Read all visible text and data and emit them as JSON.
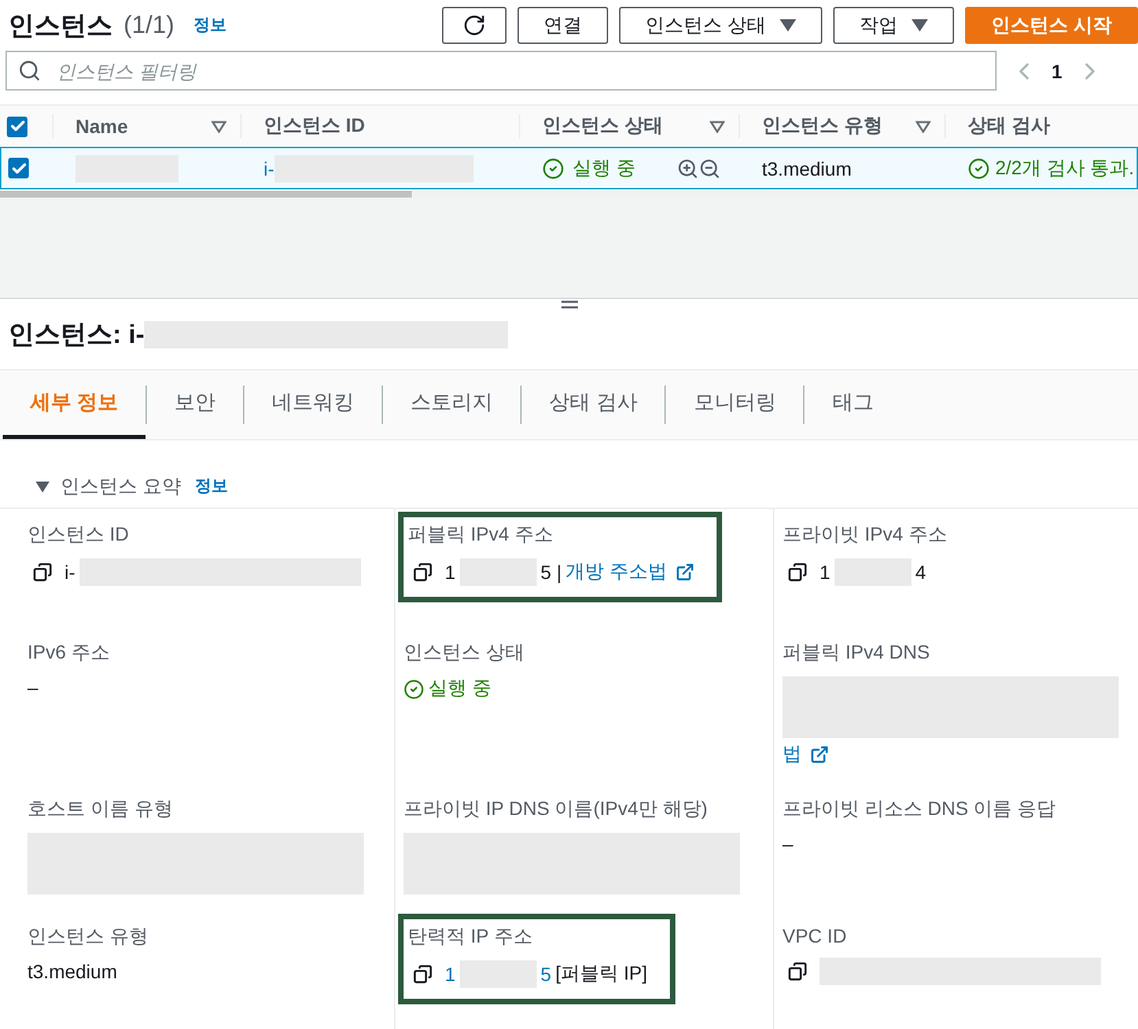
{
  "header": {
    "title": "인스턴스",
    "count": "(1/1)",
    "info": "정보"
  },
  "toolbar": [
    {
      "kind": "refresh"
    },
    {
      "kind": "plain",
      "label": "연결"
    },
    {
      "kind": "dropdown",
      "label": "인스턴스 상태"
    },
    {
      "kind": "dropdown",
      "label": "작업"
    },
    {
      "kind": "primary",
      "label": "인스턴스 시작"
    }
  ],
  "filter": {
    "placeholder": "인스턴스 필터링"
  },
  "pagination": {
    "page": "1"
  },
  "table": {
    "all_checked": true,
    "columns": [
      {
        "label": "Name",
        "filter": true
      },
      {
        "label": "인스턴스 ID",
        "filter": false
      },
      {
        "label": "인스턴스 상태",
        "filter": true
      },
      {
        "label": "인스턴스 유형",
        "filter": true
      },
      {
        "label": "상태 검사",
        "filter": false
      }
    ],
    "rows": [
      {
        "selected": true,
        "id_prefix": "i-",
        "state": "실행 중",
        "type": "t3.medium",
        "checks": "2/2개 검사 통과."
      }
    ]
  },
  "detail": {
    "title": "인스턴스: i-",
    "tabs": [
      {
        "label": "세부 정보",
        "selected": true
      },
      {
        "label": "보안",
        "selected": false
      },
      {
        "label": "네트워킹",
        "selected": false
      },
      {
        "label": "스토리지",
        "selected": false
      },
      {
        "label": "상태 검사",
        "selected": false
      },
      {
        "label": "모니터링",
        "selected": false
      },
      {
        "label": "태그",
        "selected": false
      }
    ],
    "section": {
      "title": "인스턴스 요약",
      "expanded": true,
      "info": "정보"
    },
    "fields": [
      {
        "label": "인스턴스 ID",
        "highlighted": false,
        "copyable": true,
        "value": [
          {
            "kind": "text",
            "text": "i-"
          },
          {
            "kind": "redacted_long"
          }
        ]
      },
      {
        "label": "퍼블릭 IPv4 주소",
        "highlighted": true,
        "copyable": true,
        "value": [
          {
            "kind": "text",
            "text": "1"
          },
          {
            "kind": "redacted_short"
          },
          {
            "kind": "text",
            "text": "5 |"
          },
          {
            "kind": "external",
            "text": "개방 주소법"
          }
        ]
      },
      {
        "label": "프라이빗 IPv4 주소",
        "highlighted": false,
        "copyable": true,
        "value": [
          {
            "kind": "text",
            "text": "1"
          },
          {
            "kind": "redacted_short"
          },
          {
            "kind": "text",
            "text": "4"
          }
        ]
      },
      {
        "label": "IPv6 주소",
        "highlighted": false,
        "copyable": false,
        "value": [
          {
            "kind": "text",
            "text": "–"
          }
        ]
      },
      {
        "label": "인스턴스 상태",
        "highlighted": false,
        "copyable": false,
        "value": [
          {
            "kind": "status",
            "text": "실행 중"
          }
        ]
      },
      {
        "label": "퍼블릭 IPv4 DNS",
        "highlighted": false,
        "copyable": false,
        "value": [
          {
            "kind": "redacted_block"
          },
          {
            "kind": "external",
            "text": "법"
          }
        ]
      },
      {
        "label": "호스트 이름 유형",
        "highlighted": false,
        "copyable": false,
        "value": [
          {
            "kind": "redacted_block"
          }
        ]
      },
      {
        "label": "프라이빗 IP DNS 이름(IPv4만 해당)",
        "highlighted": false,
        "copyable": false,
        "value": [
          {
            "kind": "redacted_block"
          }
        ]
      },
      {
        "label": "프라이빗 리소스 DNS 이름 응답",
        "highlighted": false,
        "copyable": false,
        "value": [
          {
            "kind": "text",
            "text": "–"
          }
        ]
      },
      {
        "label": "인스턴스 유형",
        "highlighted": false,
        "copyable": false,
        "value": [
          {
            "kind": "text",
            "text": "t3.medium"
          }
        ]
      },
      {
        "label": "탄력적 IP 주소",
        "highlighted": true,
        "copyable": true,
        "value": [
          {
            "kind": "link",
            "text": "1"
          },
          {
            "kind": "redacted_short"
          },
          {
            "kind": "link",
            "text": "5"
          },
          {
            "kind": "text",
            "text": "[퍼블릭 IP]"
          }
        ]
      },
      {
        "label": "VPC ID",
        "highlighted": false,
        "copyable": true,
        "value": [
          {
            "kind": "redacted_long"
          }
        ]
      }
    ]
  }
}
